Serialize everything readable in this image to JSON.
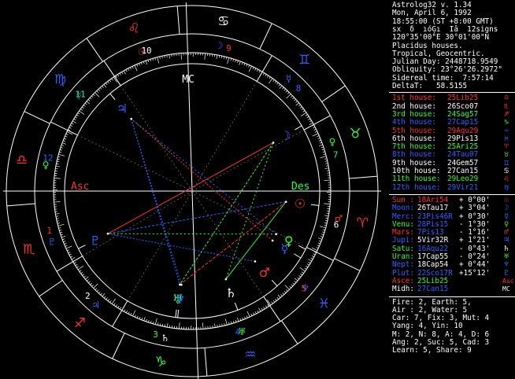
{
  "header": {
    "lines": [
      "Astrolog32 v. 1.34",
      "Mon, April 6, 1992",
      "18:55:00 (ST +8:00 GMT)",
      "sx  δ  ıόĢı  Iâ  12signs",
      "120°35'00\"E 30°01'00\"N",
      "Placidus houses.",
      "Tropical, Geocentric.",
      "Julian Day: 2448718.9549",
      "Obliquity: 23°26'26.2972\"",
      "Sidereal time:  7:57:14",
      "DeltaT:   58.5155"
    ]
  },
  "houses": [
    {
      "label": "1st house:",
      "pos": "25Lib25",
      "glyph": "♎",
      "color": "#ff3030",
      "gcolor": "#ff3030"
    },
    {
      "label": "2nd house:",
      "pos": "26Sco07",
      "glyph": "♏",
      "color": "#ffffff",
      "gcolor": "#ff3030"
    },
    {
      "label": "3rd house:",
      "pos": "24Sag57",
      "glyph": "♐",
      "color": "#30ff30",
      "gcolor": "#ff3030"
    },
    {
      "label": "4th house:",
      "pos": "27Cap15",
      "glyph": "♑",
      "color": "#3060ff",
      "gcolor": "#30ff30"
    },
    {
      "label": "5th house:",
      "pos": "29Aqu29",
      "glyph": "♒",
      "color": "#ff3030",
      "gcolor": "#3060ff"
    },
    {
      "label": "6th house:",
      "pos": "29Pis13",
      "glyph": "♓",
      "color": "#ffffff",
      "gcolor": "#3060ff"
    },
    {
      "label": "7th house:",
      "pos": "25Ari25",
      "glyph": "♈",
      "color": "#30ff30",
      "gcolor": "#ff3030"
    },
    {
      "label": "8th house:",
      "pos": "24Tau07",
      "glyph": "♉",
      "color": "#3060ff",
      "gcolor": "#30ff30"
    },
    {
      "label": "9th house:",
      "pos": "24Gem57",
      "glyph": "♊",
      "color": "#ffffff",
      "gcolor": "#3060ff"
    },
    {
      "label": "10th house:",
      "pos": "27Can15",
      "glyph": "♋",
      "color": "#ffffff",
      "gcolor": "#ffffff"
    },
    {
      "label": "11th house:",
      "pos": "29Leo29",
      "glyph": "♌",
      "color": "#30ff30",
      "gcolor": "#ff3030"
    },
    {
      "label": "12th house:",
      "pos": "29Vir21",
      "glyph": "♍",
      "color": "#3060ff",
      "gcolor": "#3060ff"
    }
  ],
  "planets": [
    {
      "label": "Sun :",
      "pos": "18Ari54",
      "aspect": "+ 0°00'",
      "glyph": "☉",
      "color": "#ff3030",
      "pcolor": "#ff3030",
      "gcolor": "#ff3030"
    },
    {
      "label": "Moon:",
      "pos": "26Tau17",
      "aspect": "+ 3°04'",
      "glyph": "☽",
      "color": "#3060ff",
      "pcolor": "#ffffff",
      "gcolor": "#3060ff"
    },
    {
      "label": "Merc:",
      "pos": "23Pis46R",
      "aspect": "+ 0°30'",
      "glyph": "☿",
      "color": "#3060ff",
      "pcolor": "#3060ff",
      "gcolor": "#3060ff"
    },
    {
      "label": "Venu:",
      "pos": "28Pis15",
      "aspect": "- 1°30'",
      "glyph": "♀",
      "color": "#30ff30",
      "pcolor": "#3060ff",
      "gcolor": "#30ff30"
    },
    {
      "label": "Mars:",
      "pos": "7Pis13",
      "aspect": "- 1°16'",
      "glyph": "♂",
      "color": "#ff3030",
      "pcolor": "#3060ff",
      "gcolor": "#ff3030"
    },
    {
      "label": "Jupi:",
      "pos": "5Vir32R",
      "aspect": "+ 1°21'",
      "glyph": "♃",
      "color": "#3060ff",
      "pcolor": "#ffffff",
      "gcolor": "#3060ff"
    },
    {
      "label": "Satu:",
      "pos": "16Aqu22",
      "aspect": "- 0°43'",
      "glyph": "♄",
      "color": "#30ff30",
      "pcolor": "#3060ff",
      "gcolor": "#ffffff"
    },
    {
      "label": "Uran:",
      "pos": "17Cap55",
      "aspect": "- 0°24'",
      "glyph": "♅",
      "color": "#30ff30",
      "pcolor": "#ffffff",
      "gcolor": "#30ff30"
    },
    {
      "label": "Nept:",
      "pos": "18Cap54",
      "aspect": "+ 0°44'",
      "glyph": "♆",
      "color": "#3060ff",
      "pcolor": "#ffffff",
      "gcolor": "#3060ff"
    },
    {
      "label": "Plut:",
      "pos": "22Sco17R",
      "aspect": "+15°12'",
      "glyph": "♇",
      "color": "#3060ff",
      "pcolor": "#3060ff",
      "gcolor": "#3060ff"
    },
    {
      "label": "Asce:",
      "pos": "25Lib25",
      "aspect": "",
      "glyph": "Asc",
      "color": "#ff3030",
      "pcolor": "#30ff30",
      "gcolor": "#ff3030"
    },
    {
      "label": "Midh:",
      "pos": "27Can15",
      "aspect": "",
      "glyph": "MC",
      "color": "#ffffff",
      "pcolor": "#3060ff",
      "gcolor": "#ffffff"
    }
  ],
  "footer": {
    "lines": [
      "Fire: 2, Earth: 5,",
      "Air : 2, Water: 5",
      "Car: 7, Fix: 3, Mut: 4",
      "Yang: 4, Yin: 10",
      "M: 2, N: 8, A: 4, D: 6",
      "Ang: 2, Suc: 5, Cad: 3",
      "Learn: 5, Share: 9"
    ]
  },
  "wheel": {
    "asc_label": "Asc",
    "des_label": "Des",
    "mc_label": "MC",
    "house_numbers": [
      {
        "n": "1",
        "color": "#ff3030"
      },
      {
        "n": "2",
        "color": "#ffffff"
      },
      {
        "n": "3",
        "color": "#30ff30"
      },
      {
        "n": "4",
        "color": "#3060ff"
      },
      {
        "n": "5",
        "color": "#ff3030"
      },
      {
        "n": "6",
        "color": "#ffffff"
      },
      {
        "n": "7",
        "color": "#30ff30"
      },
      {
        "n": "8",
        "color": "#3060ff"
      },
      {
        "n": "9",
        "color": "#ff3030"
      },
      {
        "n": "10",
        "color": "#ffffff"
      },
      {
        "n": "11",
        "color": "#30ff30"
      },
      {
        "n": "12",
        "color": "#3060ff"
      }
    ],
    "signs": [
      {
        "g": "♈",
        "color": "#ff3030"
      },
      {
        "g": "♉",
        "color": "#30ff30"
      },
      {
        "g": "♊",
        "color": "#3060ff"
      },
      {
        "g": "♋",
        "color": "#ffffff"
      },
      {
        "g": "♌",
        "color": "#ff3030"
      },
      {
        "g": "♍",
        "color": "#3060ff"
      },
      {
        "g": "♎",
        "color": "#ff3030"
      },
      {
        "g": "♏",
        "color": "#ff3030"
      },
      {
        "g": "♐",
        "color": "#ff3030"
      },
      {
        "g": "♑",
        "color": "#30ff30"
      },
      {
        "g": "♒",
        "color": "#3060ff"
      },
      {
        "g": "♓",
        "color": "#3060ff"
      }
    ],
    "rulers": [
      {
        "g": "♂",
        "color": "#ff3030"
      },
      {
        "g": "♀",
        "color": "#30ff30"
      },
      {
        "g": "☿",
        "color": "#3060ff"
      },
      {
        "g": "☽",
        "color": "#3060ff"
      },
      {
        "g": "☉",
        "color": "#ff3030"
      },
      {
        "g": "☿",
        "color": "#3060ff"
      },
      {
        "g": "♀",
        "color": "#30ff30"
      },
      {
        "g": "♇",
        "color": "#3060ff"
      },
      {
        "g": "♃",
        "color": "#3060ff"
      },
      {
        "g": "♄",
        "color": "#ffffff"
      },
      {
        "g": "♅",
        "color": "#30ff30"
      },
      {
        "g": "♆",
        "color": "#3060ff"
      }
    ]
  }
}
